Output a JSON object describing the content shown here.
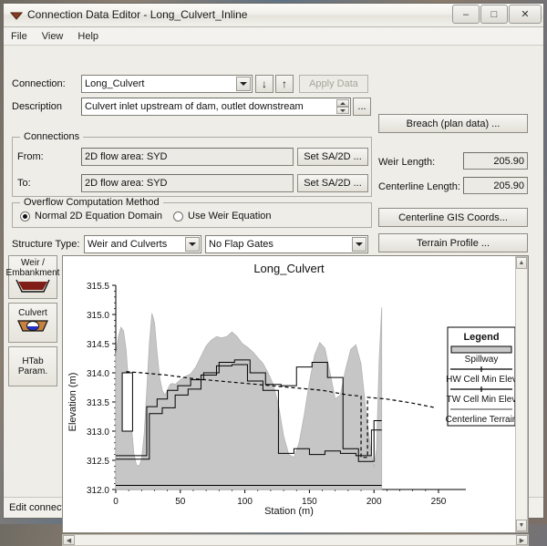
{
  "window": {
    "title": "Connection Data Editor - Long_Culvert_Inline",
    "icon": "connection-editor-icon",
    "minimize": "–",
    "maximize": "□",
    "close": "✕"
  },
  "menu": {
    "items": [
      "File",
      "View",
      "Help"
    ]
  },
  "form": {
    "connection_label": "Connection:",
    "connection_value": "Long_Culvert",
    "nav_down": "↓",
    "nav_up": "↑",
    "apply_data": "Apply Data",
    "description_label": "Description",
    "description_value": "Culvert inlet upstream of dam, outlet downstream",
    "description_ellipsis": "...",
    "connections_group": "Connections",
    "from_label": "From:",
    "from_value": "2D flow area: SYD",
    "from_button": "Set SA/2D ...",
    "to_label": "To:",
    "to_value": "2D flow area: SYD",
    "to_button": "Set SA/2D ...",
    "overflow_group": "Overflow Computation Method",
    "overflow_options": [
      {
        "label": "Normal 2D Equation Domain",
        "selected": true
      },
      {
        "label": "Use Weir Equation",
        "selected": false
      }
    ],
    "structure_type_label": "Structure Type:",
    "structure_type_value": "Weir and Culverts",
    "flap_gates_value": "No Flap Gates"
  },
  "right_panel": {
    "breach_button": "Breach (plan data) ...",
    "weir_length_label": "Weir Length:",
    "weir_length_value": "205.90",
    "centerline_length_label": "Centerline Length:",
    "centerline_length_value": "205.90",
    "centerline_gis_button": "Centerline GIS Coords...",
    "terrain_profile_button": "Terrain Profile ..."
  },
  "side_tabs": [
    {
      "name": "weir-embankment",
      "line1": "Weir /",
      "line2": "Embankment",
      "icon": "weir-embankment-icon"
    },
    {
      "name": "culvert",
      "line1": "Culvert",
      "line2": "",
      "icon": "culvert-icon"
    },
    {
      "name": "htab-param",
      "line1": "HTab",
      "line2": "Param.",
      "icon": ""
    }
  ],
  "statusbar": {
    "text": "Edit connection description"
  },
  "chart_data": {
    "type": "area",
    "title": "Long_Culvert",
    "xlabel": "Station (m)",
    "ylabel": "Elevation (m)",
    "xlim": [
      0,
      250
    ],
    "ylim": [
      312.0,
      315.5
    ],
    "xticks": [
      0,
      50,
      100,
      150,
      200,
      250
    ],
    "yticks": [
      312.0,
      312.5,
      313.0,
      313.5,
      314.0,
      314.5,
      315.0,
      315.5
    ],
    "grid": false,
    "legend_title": "Legend",
    "legend_position": "right",
    "legend": [
      {
        "label": "Spillway",
        "style": "filled-bar",
        "color": "#c9c9c9"
      },
      {
        "label": "HW Cell Min Elev",
        "style": "line-marker",
        "color": "#000000"
      },
      {
        "label": "TW Cell Min Elev",
        "style": "line-marker",
        "color": "#000000"
      },
      {
        "label": "Centerline Terrain",
        "style": "thin-line",
        "color": "#000000"
      }
    ],
    "series": [
      {
        "name": "Spillway",
        "type": "filled-profile",
        "x": [
          0,
          2,
          4,
          6,
          8,
          10,
          12,
          14,
          16,
          18,
          20,
          22,
          24,
          26,
          28,
          30,
          32,
          34,
          36,
          38,
          40,
          42,
          44,
          46,
          48,
          50,
          54,
          58,
          62,
          66,
          70,
          74,
          78,
          82,
          86,
          90,
          94,
          98,
          102,
          106,
          110,
          114,
          118,
          122,
          126,
          130,
          134,
          138,
          142,
          146,
          150,
          154,
          158,
          162,
          166,
          170,
          174,
          178,
          182,
          186,
          190,
          194,
          198,
          200,
          202,
          204,
          206
        ],
        "y": [
          314.3,
          314.62,
          314.78,
          314.72,
          314.4,
          313.78,
          313.12,
          312.62,
          312.42,
          312.4,
          312.52,
          312.95,
          313.7,
          314.5,
          315.02,
          314.86,
          314.35,
          313.92,
          313.7,
          313.62,
          313.7,
          313.8,
          313.82,
          313.8,
          313.84,
          313.88,
          313.94,
          313.98,
          314.1,
          314.28,
          314.46,
          314.56,
          314.62,
          314.6,
          314.62,
          314.7,
          314.62,
          314.5,
          314.44,
          314.36,
          314.26,
          314.16,
          314.0,
          313.8,
          313.45,
          312.92,
          312.6,
          312.55,
          312.8,
          313.28,
          313.84,
          314.3,
          314.52,
          314.42,
          314.0,
          313.55,
          313.62,
          314.06,
          314.4,
          314.48,
          314.15,
          313.3,
          312.6,
          312.38,
          312.7,
          314.2,
          315.12
        ]
      },
      {
        "name": "HW Cell Min Elev",
        "type": "step",
        "x": [
          0,
          10,
          10,
          24,
          24,
          32,
          32,
          40,
          40,
          48,
          48,
          58,
          58,
          68,
          68,
          80,
          80,
          92,
          92,
          104,
          104,
          116,
          116,
          128,
          128,
          140,
          140,
          152,
          152,
          164,
          164,
          176,
          176,
          188,
          188,
          200,
          200,
          206
        ],
        "y": [
          312.58,
          312.58,
          312.58,
          312.58,
          313.42,
          313.42,
          313.55,
          313.55,
          313.7,
          313.7,
          313.78,
          313.78,
          313.88,
          313.88,
          314.0,
          314.0,
          314.18,
          314.18,
          314.22,
          314.22,
          314.0,
          314.0,
          313.8,
          313.8,
          313.78,
          313.78,
          314.1,
          314.1,
          314.18,
          314.18,
          313.92,
          313.92,
          312.7,
          312.7,
          312.48,
          312.48,
          313.18,
          313.18
        ]
      },
      {
        "name": "TW Cell Min Elev",
        "type": "step",
        "x": [
          0,
          12,
          12,
          26,
          26,
          36,
          36,
          46,
          46,
          56,
          56,
          66,
          66,
          78,
          78,
          90,
          90,
          102,
          102,
          114,
          114,
          126,
          126,
          138,
          138,
          150,
          150,
          162,
          162,
          174,
          174,
          186,
          186,
          198,
          198,
          206
        ],
        "y": [
          312.52,
          312.52,
          312.52,
          312.52,
          313.3,
          313.3,
          313.4,
          313.4,
          313.62,
          313.62,
          313.72,
          313.72,
          313.96,
          313.96,
          314.12,
          314.12,
          314.14,
          314.14,
          313.86,
          313.86,
          313.7,
          313.7,
          312.62,
          312.62,
          312.7,
          312.7,
          312.6,
          312.6,
          312.66,
          312.66,
          312.62,
          312.62,
          312.58,
          312.58,
          313.02,
          313.02
        ]
      },
      {
        "name": "Centerline Terrain",
        "type": "dashed-line",
        "x": [
          8,
          20,
          40,
          60,
          80,
          100,
          120,
          140,
          160,
          180,
          190,
          190,
          195,
          195,
          210,
          230,
          248
        ],
        "y": [
          314.02,
          314.0,
          313.96,
          313.9,
          313.86,
          313.82,
          313.78,
          313.74,
          313.7,
          313.62,
          313.6,
          312.55,
          312.55,
          313.58,
          313.55,
          313.48,
          313.4
        ]
      },
      {
        "name": "Culvert Opening",
        "type": "rect",
        "x0": 5,
        "x1": 13,
        "y0": 313.0,
        "y1": 314.0
      }
    ]
  }
}
